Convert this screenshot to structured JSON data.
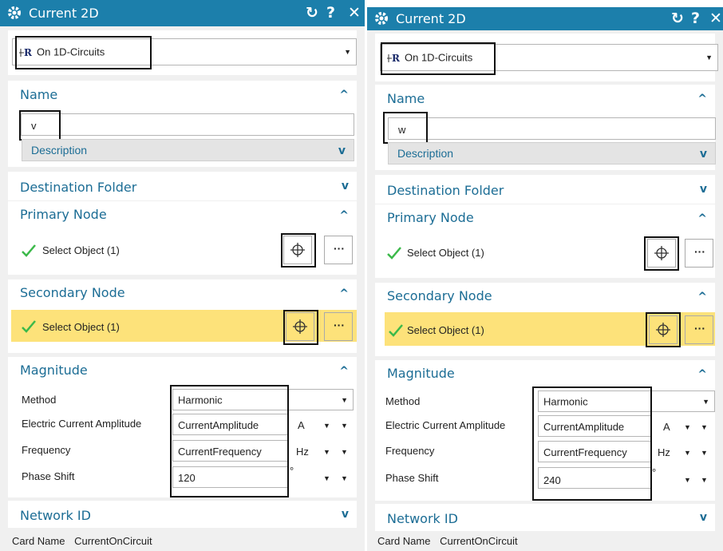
{
  "panels": [
    {
      "title": "Current 2D",
      "buttons": {
        "reset": "↻",
        "help": "?",
        "close": "✕"
      },
      "type_selector": {
        "value": "On 1D-Circuits"
      },
      "name_section": {
        "title": "Name",
        "value": "v",
        "description_label": "Description"
      },
      "destination": {
        "title": "Destination Folder"
      },
      "primary": {
        "title": "Primary Node",
        "select_label": "Select Object (1)"
      },
      "secondary": {
        "title": "Secondary Node",
        "select_label": "Select Object (1)"
      },
      "magnitude": {
        "title": "Magnitude",
        "method_label": "Method",
        "method_value": "Harmonic",
        "amplitude_label": "Electric Current Amplitude",
        "amplitude_value": "CurrentAmplitude",
        "amplitude_unit": "A",
        "frequency_label": "Frequency",
        "frequency_value": "CurrentFrequency",
        "frequency_unit": "Hz",
        "phase_label": "Phase Shift",
        "phase_value": "120",
        "phase_unit": "°"
      },
      "network": {
        "title": "Network ID"
      },
      "footer": {
        "label": "Card Name",
        "value": "CurrentOnCircuit"
      }
    },
    {
      "title": "Current 2D",
      "buttons": {
        "reset": "↻",
        "help": "?",
        "close": "✕"
      },
      "type_selector": {
        "value": "On 1D-Circuits"
      },
      "name_section": {
        "title": "Name",
        "value": "w",
        "description_label": "Description"
      },
      "destination": {
        "title": "Destination Folder"
      },
      "primary": {
        "title": "Primary Node",
        "select_label": "Select Object (1)"
      },
      "secondary": {
        "title": "Secondary Node",
        "select_label": "Select Object (1)"
      },
      "magnitude": {
        "title": "Magnitude",
        "method_label": "Method",
        "method_value": "Harmonic",
        "amplitude_label": "Electric Current Amplitude",
        "amplitude_value": "CurrentAmplitude",
        "amplitude_unit": "A",
        "frequency_label": "Frequency",
        "frequency_value": "CurrentFrequency",
        "frequency_unit": "Hz",
        "phase_label": "Phase Shift",
        "phase_value": "240",
        "phase_unit": "°"
      },
      "network": {
        "title": "Network ID"
      },
      "footer": {
        "label": "Card Name",
        "value": "CurrentOnCircuit"
      }
    }
  ],
  "icons": {
    "type": "circuit-icon",
    "gear": "gear-icon",
    "target": "crosshair-icon",
    "check": "check-icon"
  },
  "colors": {
    "titlebar": "#1c7fab",
    "section_title": "#1c6d95",
    "highlight_row": "#fde27a",
    "check": "#3cb94a"
  }
}
